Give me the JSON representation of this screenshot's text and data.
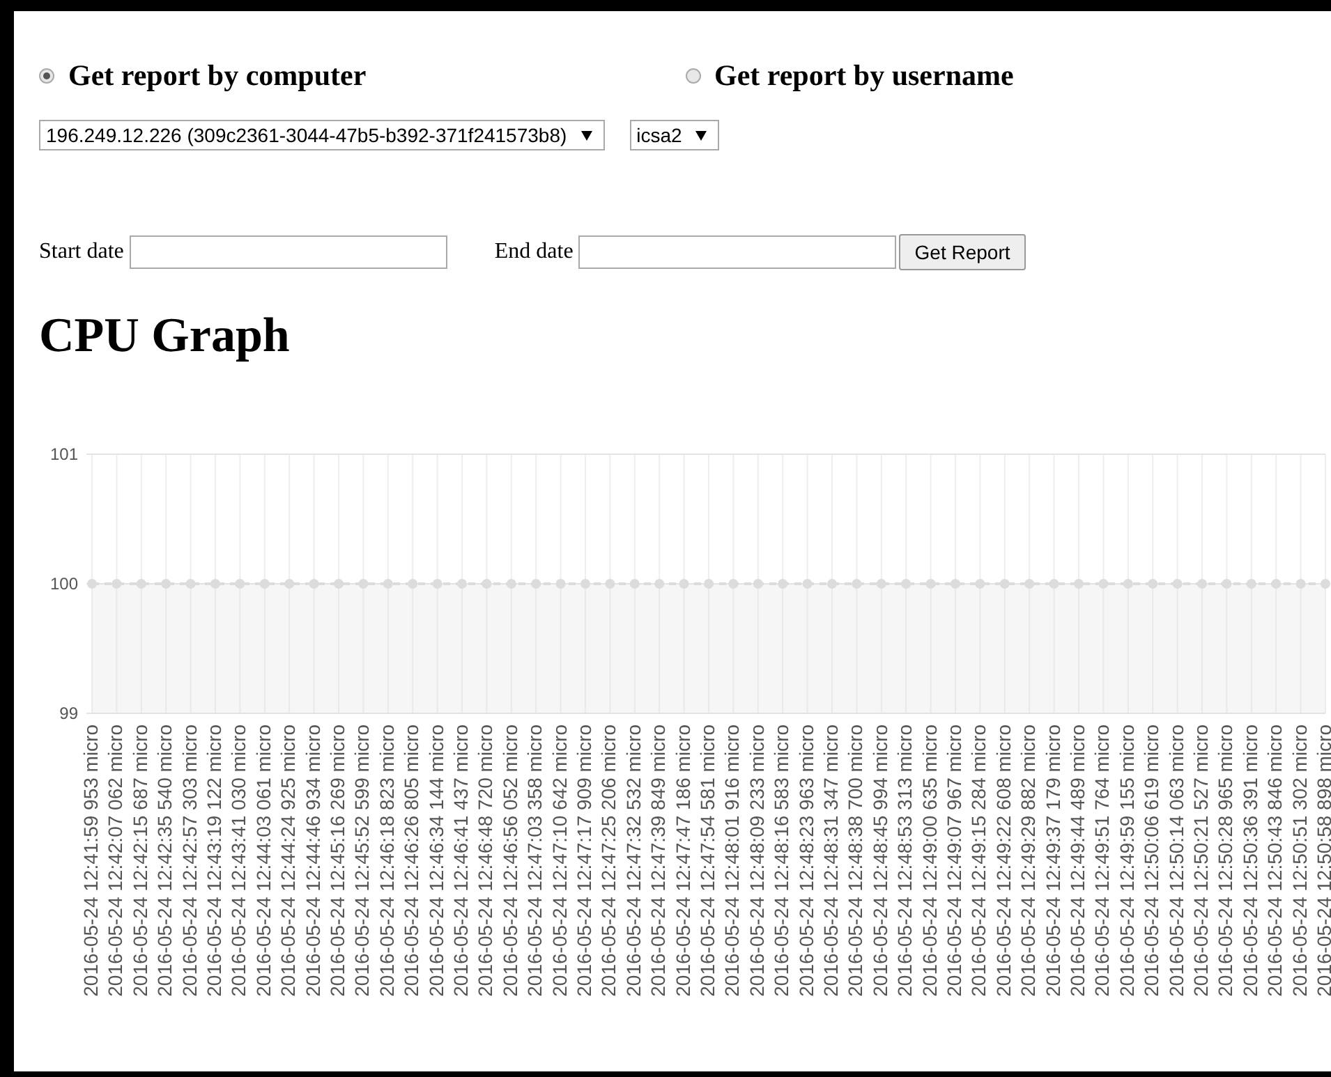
{
  "report_mode": [
    {
      "label": "Get report by computer",
      "selected": true
    },
    {
      "label": "Get report by username",
      "selected": false
    }
  ],
  "computer_select": {
    "value": "196.249.12.226 (309c2361-3044-47b5-b392-371f241573b8)"
  },
  "user_select": {
    "value": "icsa2"
  },
  "start_date": {
    "label": "Start date"
  },
  "end_date": {
    "label": "End date"
  },
  "submit_button": "Get Report",
  "graph": {
    "title": "CPU Graph",
    "chart_data": {
      "type": "area",
      "categories": [
        "2016-05-24 12:41:59 953 micro",
        "2016-05-24 12:42:07 062 micro",
        "2016-05-24 12:42:15 687 micro",
        "2016-05-24 12:42:35 540 micro",
        "2016-05-24 12:42:57 303 micro",
        "2016-05-24 12:43:19 122 micro",
        "2016-05-24 12:43:41 030 micro",
        "2016-05-24 12:44:03 061 micro",
        "2016-05-24 12:44:24 925 micro",
        "2016-05-24 12:44:46 934 micro",
        "2016-05-24 12:45:16 269 micro",
        "2016-05-24 12:45:52 599 micro",
        "2016-05-24 12:46:18 823 micro",
        "2016-05-24 12:46:26 805 micro",
        "2016-05-24 12:46:34 144 micro",
        "2016-05-24 12:46:41 437 micro",
        "2016-05-24 12:46:48 720 micro",
        "2016-05-24 12:46:56 052 micro",
        "2016-05-24 12:47:03 358 micro",
        "2016-05-24 12:47:10 642 micro",
        "2016-05-24 12:47:17 909 micro",
        "2016-05-24 12:47:25 206 micro",
        "2016-05-24 12:47:32 532 micro",
        "2016-05-24 12:47:39 849 micro",
        "2016-05-24 12:47:47 186 micro",
        "2016-05-24 12:47:54 581 micro",
        "2016-05-24 12:48:01 916 micro",
        "2016-05-24 12:48:09 233 micro",
        "2016-05-24 12:48:16 583 micro",
        "2016-05-24 12:48:23 963 micro",
        "2016-05-24 12:48:31 347 micro",
        "2016-05-24 12:48:38 700 micro",
        "2016-05-24 12:48:45 994 micro",
        "2016-05-24 12:48:53 313 micro",
        "2016-05-24 12:49:00 635 micro",
        "2016-05-24 12:49:07 967 micro",
        "2016-05-24 12:49:15 284 micro",
        "2016-05-24 12:49:22 608 micro",
        "2016-05-24 12:49:29 882 micro",
        "2016-05-24 12:49:37 179 micro",
        "2016-05-24 12:49:44 489 micro",
        "2016-05-24 12:49:51 764 micro",
        "2016-05-24 12:49:59 155 micro",
        "2016-05-24 12:50:06 619 micro",
        "2016-05-24 12:50:14 063 micro",
        "2016-05-24 12:50:21 527 micro",
        "2016-05-24 12:50:28 965 micro",
        "2016-05-24 12:50:36 391 micro",
        "2016-05-24 12:50:43 846 micro",
        "2016-05-24 12:50:51 302 micro",
        "2016-05-24 12:50:58 898 micro"
      ],
      "series": [
        {
          "color": "#dcdcdc",
          "values": [
            100,
            100,
            100,
            100,
            100,
            100,
            100,
            100,
            100,
            100,
            100,
            100,
            100,
            100,
            100,
            100,
            100,
            100,
            100,
            100,
            100,
            100,
            100,
            100,
            100,
            100,
            100,
            100,
            100,
            100,
            100,
            100,
            100,
            100,
            100,
            100,
            100,
            100,
            100,
            100,
            100,
            100,
            100,
            100,
            100,
            100,
            100,
            100,
            100,
            100,
            100
          ]
        }
      ],
      "ylim": [
        99,
        101
      ],
      "yticks": [
        99,
        100,
        101
      ],
      "grid": true
    }
  }
}
